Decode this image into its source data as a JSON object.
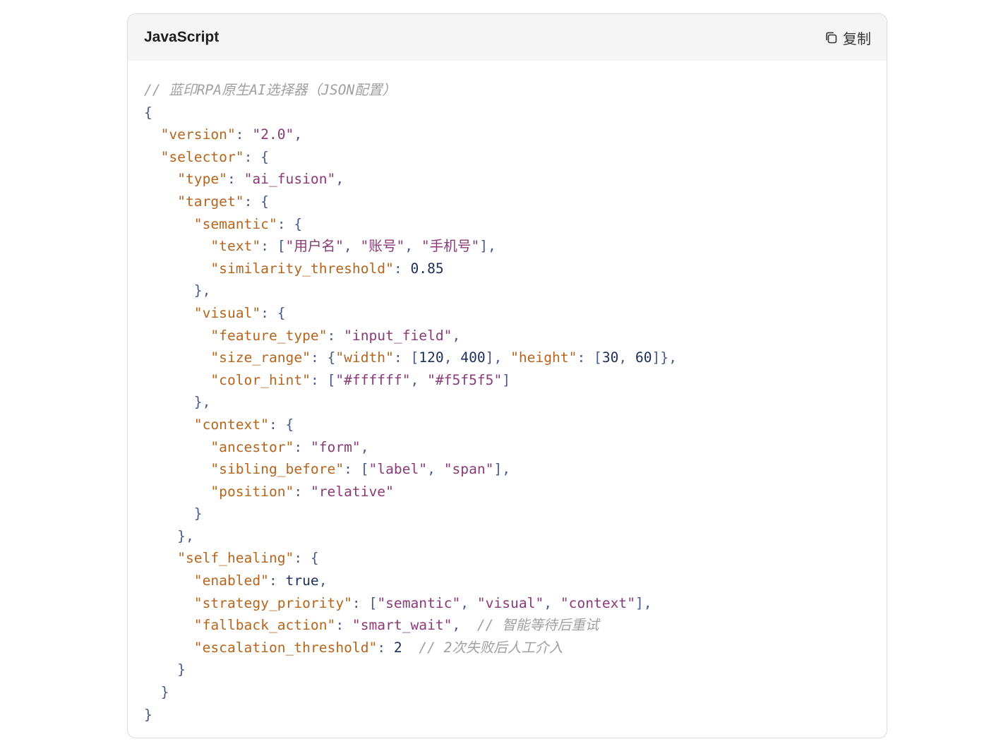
{
  "code_block": {
    "language": "JavaScript",
    "copy_label": "复制",
    "copy_icon": "copy-icon"
  },
  "colors": {
    "key": "#b5651d",
    "string": "#8b3a78",
    "number": "#1c2f57",
    "punctuation": "#4a5a8a",
    "comment": "#a0a0a0",
    "header_bg": "#f5f5f5",
    "border": "#dcdcdc"
  },
  "code_lines": [
    [
      {
        "t": "// 蓝印RPA原生AI选择器（JSON配置）",
        "c": "com"
      }
    ],
    [
      {
        "t": "{",
        "c": "pun"
      }
    ],
    [
      {
        "t": "  ",
        "c": "pun"
      },
      {
        "t": "\"version\"",
        "c": "key"
      },
      {
        "t": ": ",
        "c": "pun"
      },
      {
        "t": "\"2.0\"",
        "c": "str"
      },
      {
        "t": ",",
        "c": "pun"
      }
    ],
    [
      {
        "t": "  ",
        "c": "pun"
      },
      {
        "t": "\"selector\"",
        "c": "key"
      },
      {
        "t": ": {",
        "c": "pun"
      }
    ],
    [
      {
        "t": "    ",
        "c": "pun"
      },
      {
        "t": "\"type\"",
        "c": "key"
      },
      {
        "t": ": ",
        "c": "pun"
      },
      {
        "t": "\"ai_fusion\"",
        "c": "str"
      },
      {
        "t": ",",
        "c": "pun"
      }
    ],
    [
      {
        "t": "    ",
        "c": "pun"
      },
      {
        "t": "\"target\"",
        "c": "key"
      },
      {
        "t": ": {",
        "c": "pun"
      }
    ],
    [
      {
        "t": "      ",
        "c": "pun"
      },
      {
        "t": "\"semantic\"",
        "c": "key"
      },
      {
        "t": ": {",
        "c": "pun"
      }
    ],
    [
      {
        "t": "        ",
        "c": "pun"
      },
      {
        "t": "\"text\"",
        "c": "key"
      },
      {
        "t": ": [",
        "c": "pun"
      },
      {
        "t": "\"用户名\"",
        "c": "str"
      },
      {
        "t": ", ",
        "c": "pun"
      },
      {
        "t": "\"账号\"",
        "c": "str"
      },
      {
        "t": ", ",
        "c": "pun"
      },
      {
        "t": "\"手机号\"",
        "c": "str"
      },
      {
        "t": "],",
        "c": "pun"
      }
    ],
    [
      {
        "t": "        ",
        "c": "pun"
      },
      {
        "t": "\"similarity_threshold\"",
        "c": "key"
      },
      {
        "t": ": ",
        "c": "pun"
      },
      {
        "t": "0.85",
        "c": "num"
      }
    ],
    [
      {
        "t": "      },",
        "c": "pun"
      }
    ],
    [
      {
        "t": "      ",
        "c": "pun"
      },
      {
        "t": "\"visual\"",
        "c": "key"
      },
      {
        "t": ": {",
        "c": "pun"
      }
    ],
    [
      {
        "t": "        ",
        "c": "pun"
      },
      {
        "t": "\"feature_type\"",
        "c": "key"
      },
      {
        "t": ": ",
        "c": "pun"
      },
      {
        "t": "\"input_field\"",
        "c": "str"
      },
      {
        "t": ",",
        "c": "pun"
      }
    ],
    [
      {
        "t": "        ",
        "c": "pun"
      },
      {
        "t": "\"size_range\"",
        "c": "key"
      },
      {
        "t": ": {",
        "c": "pun"
      },
      {
        "t": "\"width\"",
        "c": "key"
      },
      {
        "t": ": [",
        "c": "pun"
      },
      {
        "t": "120",
        "c": "num"
      },
      {
        "t": ", ",
        "c": "pun"
      },
      {
        "t": "400",
        "c": "num"
      },
      {
        "t": "], ",
        "c": "pun"
      },
      {
        "t": "\"height\"",
        "c": "key"
      },
      {
        "t": ": [",
        "c": "pun"
      },
      {
        "t": "30",
        "c": "num"
      },
      {
        "t": ", ",
        "c": "pun"
      },
      {
        "t": "60",
        "c": "num"
      },
      {
        "t": "]},",
        "c": "pun"
      }
    ],
    [
      {
        "t": "        ",
        "c": "pun"
      },
      {
        "t": "\"color_hint\"",
        "c": "key"
      },
      {
        "t": ": [",
        "c": "pun"
      },
      {
        "t": "\"#ffffff\"",
        "c": "str"
      },
      {
        "t": ", ",
        "c": "pun"
      },
      {
        "t": "\"#f5f5f5\"",
        "c": "str"
      },
      {
        "t": "]",
        "c": "pun"
      }
    ],
    [
      {
        "t": "      },",
        "c": "pun"
      }
    ],
    [
      {
        "t": "      ",
        "c": "pun"
      },
      {
        "t": "\"context\"",
        "c": "key"
      },
      {
        "t": ": {",
        "c": "pun"
      }
    ],
    [
      {
        "t": "        ",
        "c": "pun"
      },
      {
        "t": "\"ancestor\"",
        "c": "key"
      },
      {
        "t": ": ",
        "c": "pun"
      },
      {
        "t": "\"form\"",
        "c": "str"
      },
      {
        "t": ",",
        "c": "pun"
      }
    ],
    [
      {
        "t": "        ",
        "c": "pun"
      },
      {
        "t": "\"sibling_before\"",
        "c": "key"
      },
      {
        "t": ": [",
        "c": "pun"
      },
      {
        "t": "\"label\"",
        "c": "str"
      },
      {
        "t": ", ",
        "c": "pun"
      },
      {
        "t": "\"span\"",
        "c": "str"
      },
      {
        "t": "],",
        "c": "pun"
      }
    ],
    [
      {
        "t": "        ",
        "c": "pun"
      },
      {
        "t": "\"position\"",
        "c": "key"
      },
      {
        "t": ": ",
        "c": "pun"
      },
      {
        "t": "\"relative\"",
        "c": "str"
      }
    ],
    [
      {
        "t": "      }",
        "c": "pun"
      }
    ],
    [
      {
        "t": "    },",
        "c": "pun"
      }
    ],
    [
      {
        "t": "    ",
        "c": "pun"
      },
      {
        "t": "\"self_healing\"",
        "c": "key"
      },
      {
        "t": ": {",
        "c": "pun"
      }
    ],
    [
      {
        "t": "      ",
        "c": "pun"
      },
      {
        "t": "\"enabled\"",
        "c": "key"
      },
      {
        "t": ": ",
        "c": "pun"
      },
      {
        "t": "true",
        "c": "kw"
      },
      {
        "t": ",",
        "c": "pun"
      }
    ],
    [
      {
        "t": "      ",
        "c": "pun"
      },
      {
        "t": "\"strategy_priority\"",
        "c": "key"
      },
      {
        "t": ": [",
        "c": "pun"
      },
      {
        "t": "\"semantic\"",
        "c": "str"
      },
      {
        "t": ", ",
        "c": "pun"
      },
      {
        "t": "\"visual\"",
        "c": "str"
      },
      {
        "t": ", ",
        "c": "pun"
      },
      {
        "t": "\"context\"",
        "c": "str"
      },
      {
        "t": "],",
        "c": "pun"
      }
    ],
    [
      {
        "t": "      ",
        "c": "pun"
      },
      {
        "t": "\"fallback_action\"",
        "c": "key"
      },
      {
        "t": ": ",
        "c": "pun"
      },
      {
        "t": "\"smart_wait\"",
        "c": "str"
      },
      {
        "t": ",  ",
        "c": "pun"
      },
      {
        "t": "// 智能等待后重试",
        "c": "com"
      }
    ],
    [
      {
        "t": "      ",
        "c": "pun"
      },
      {
        "t": "\"escalation_threshold\"",
        "c": "key"
      },
      {
        "t": ": ",
        "c": "pun"
      },
      {
        "t": "2",
        "c": "num"
      },
      {
        "t": "  ",
        "c": "pun"
      },
      {
        "t": "// 2次失败后人工介入",
        "c": "com"
      }
    ],
    [
      {
        "t": "    }",
        "c": "pun"
      }
    ],
    [
      {
        "t": "  }",
        "c": "pun"
      }
    ],
    [
      {
        "t": "}",
        "c": "pun"
      }
    ]
  ]
}
